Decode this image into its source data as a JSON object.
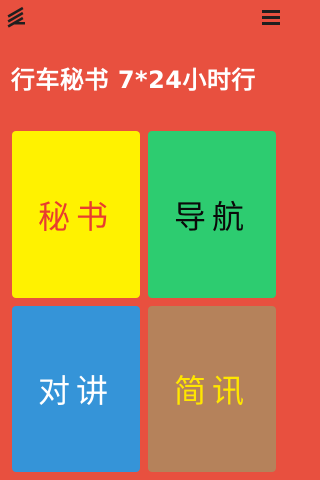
{
  "header": {
    "logo_icon": "app-logo-icon",
    "menu_icon": "hamburger-menu-icon"
  },
  "banner": {
    "text": "行车秘书  7*24小时行"
  },
  "tiles": [
    {
      "label": "秘书",
      "color": "#fff200",
      "text_color": "#e83d2f"
    },
    {
      "label": "导航",
      "color": "#2dcc70",
      "text_color": "#0a0a0a"
    },
    {
      "label": "对讲",
      "color": "#3594d8",
      "text_color": "#ffffff"
    },
    {
      "label": "简讯",
      "color": "#b5825b",
      "text_color": "#ffe600"
    }
  ],
  "theme": {
    "background": "#e8503f"
  }
}
